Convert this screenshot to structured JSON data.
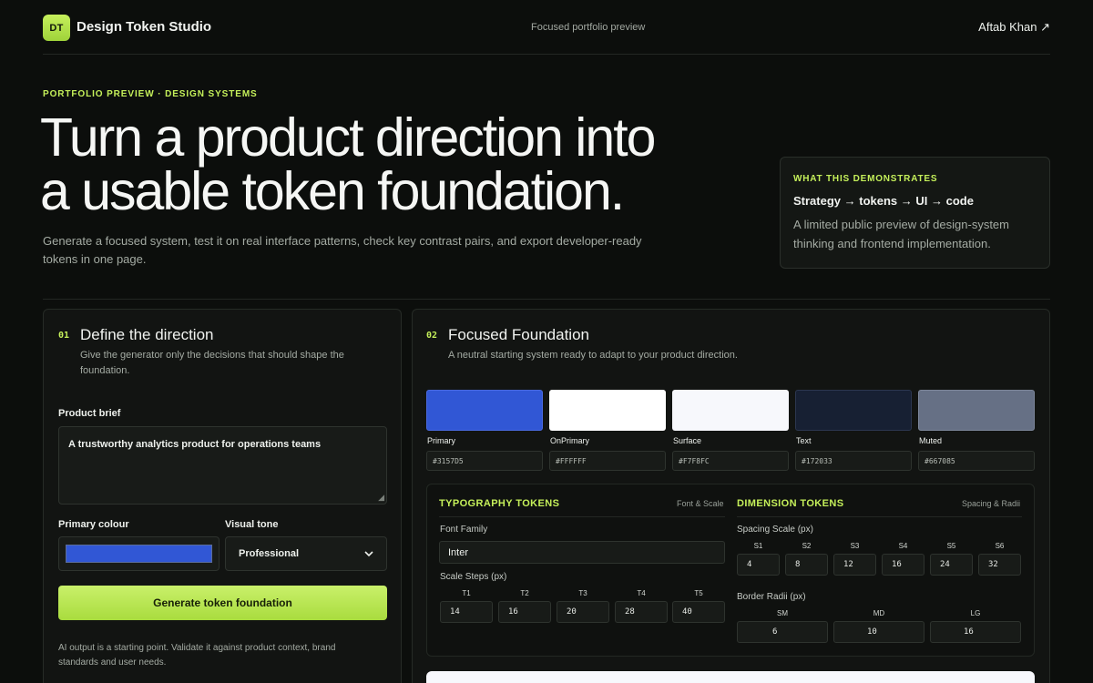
{
  "header": {
    "logo_text": "DT",
    "brand": "Design Token Studio",
    "center_note": "Focused portfolio preview",
    "author": "Aftab Khan ↗"
  },
  "hero": {
    "eyebrow": "PORTFOLIO PREVIEW · DESIGN SYSTEMS",
    "line1": "Turn a product direction into",
    "line2": "a usable token foundation.",
    "subtitle": "Generate a focused system, test it on real interface patterns, check key contrast pairs, and export developer-ready tokens in one page."
  },
  "demo": {
    "eyebrow": "WHAT THIS DEMONSTRATES",
    "title": "Strategy → tokens → UI → code",
    "desc": "A limited public preview of design-system thinking and frontend implementation."
  },
  "step1": {
    "num": "01",
    "title": "Define the direction",
    "sub": "Give the generator only the decisions that should shape the foundation.",
    "brief_label": "Product brief",
    "brief_value": "A trustworthy analytics product for operations teams",
    "colour_label": "Primary colour",
    "colour_value": "#3157D5",
    "tone_label": "Visual tone",
    "tone_value": "Professional",
    "generate_label": "Generate token foundation",
    "disclaimer": "AI output is a starting point. Validate it against product context, brand standards and user needs."
  },
  "step2": {
    "num": "02",
    "title": "Focused Foundation",
    "sub": "A neutral starting system ready to adapt to your product direction.",
    "swatches": [
      {
        "name": "Primary",
        "hex": "#3157D5",
        "color": "#3157D5"
      },
      {
        "name": "OnPrimary",
        "hex": "#FFFFFF",
        "color": "#FFFFFF"
      },
      {
        "name": "Surface",
        "hex": "#F7F8FC",
        "color": "#F7F8FC"
      },
      {
        "name": "Text",
        "hex": "#172033",
        "color": "#172033"
      },
      {
        "name": "Muted",
        "hex": "#667085",
        "color": "#667085"
      }
    ],
    "typography": {
      "title": "TYPOGRAPHY TOKENS",
      "note": "Font & Scale",
      "font_family_label": "Font Family",
      "font_family_value": "Inter",
      "scale_label": "Scale Steps (px)",
      "steps": [
        {
          "key": "T1",
          "value": "14"
        },
        {
          "key": "T2",
          "value": "16"
        },
        {
          "key": "T3",
          "value": "20"
        },
        {
          "key": "T4",
          "value": "28"
        },
        {
          "key": "T5",
          "value": "40"
        }
      ]
    },
    "dimension": {
      "title": "DIMENSION TOKENS",
      "note": "Spacing & Radii",
      "spacing_label": "Spacing Scale (px)",
      "spacing": [
        {
          "key": "S1",
          "value": "4"
        },
        {
          "key": "S2",
          "value": "8"
        },
        {
          "key": "S3",
          "value": "12"
        },
        {
          "key": "S4",
          "value": "16"
        },
        {
          "key": "S5",
          "value": "24"
        },
        {
          "key": "S6",
          "value": "32"
        }
      ],
      "radii_label": "Border Radii (px)",
      "radii": [
        {
          "key": "SM",
          "value": "6"
        },
        {
          "key": "MD",
          "value": "10"
        },
        {
          "key": "LG",
          "value": "16"
        }
      ]
    }
  },
  "colors": {
    "accent": "#C5F05A",
    "background": "#0C0E0C"
  }
}
